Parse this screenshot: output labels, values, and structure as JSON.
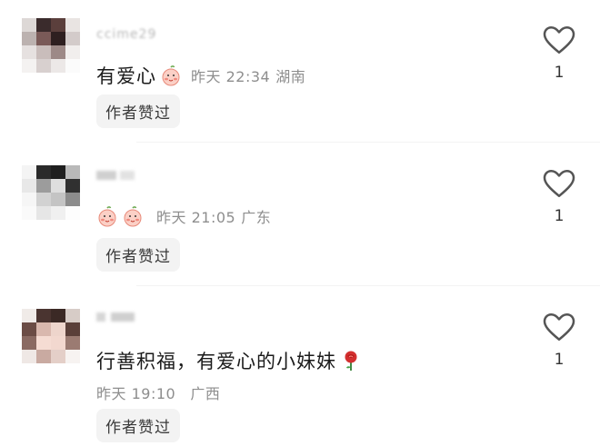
{
  "comments": [
    {
      "username": "ccime29",
      "text": "有爱心",
      "emojis": [
        "peach-cheek-emoji"
      ],
      "time": "昨天 22:34",
      "location": "湖南",
      "author_liked": "作者赞过",
      "like_count": "1"
    },
    {
      "username": "",
      "text": "",
      "emojis": [
        "peach-cheek-emoji",
        "peach-cheek-emoji"
      ],
      "time": "昨天 21:05",
      "location": "广东",
      "author_liked": "作者赞过",
      "like_count": "1"
    },
    {
      "username": "",
      "text": "行善积福，有爱心的小妹妹",
      "emojis": [
        "rose-emoji"
      ],
      "time": "昨天 19:10",
      "location": "广西",
      "author_liked": "作者赞过",
      "like_count": "1"
    }
  ],
  "icons": {
    "like": "heart-outline-icon"
  },
  "colors": {
    "meta": "#8e8e8e",
    "badge_bg": "#f3f3f3",
    "heart_stroke": "#555555"
  }
}
